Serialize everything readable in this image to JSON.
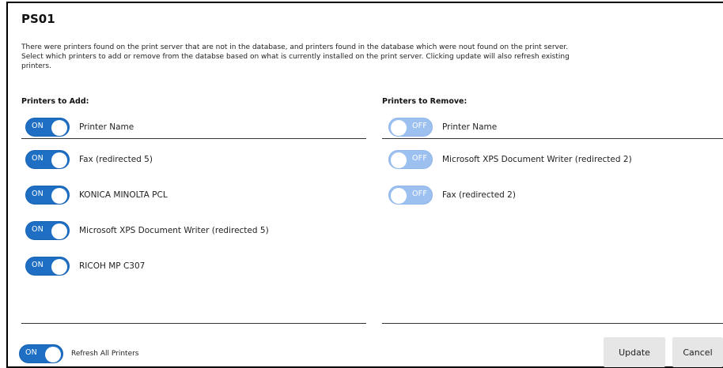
{
  "dialog": {
    "title": "PS01",
    "description": "There were printers found on the print server that are not in the database, and printers found in the database which were nout found on the print server. Select which printers to add or remove from the databse based on what is currently installed on the print server. Clicking update will also refresh existing printers."
  },
  "add_column": {
    "title": "Printers to Add:",
    "header": {
      "label": "Printer Name",
      "state": "ON"
    },
    "items": [
      {
        "label": "Fax (redirected 5)",
        "state": "ON"
      },
      {
        "label": "KONICA MINOLTA PCL",
        "state": "ON"
      },
      {
        "label": "Microsoft XPS Document Writer (redirected 5)",
        "state": "ON"
      },
      {
        "label": "RICOH MP C307",
        "state": "ON"
      }
    ]
  },
  "remove_column": {
    "title": "Printers to Remove:",
    "header": {
      "label": "Printer Name",
      "state": "OFF"
    },
    "items": [
      {
        "label": "Microsoft XPS Document Writer (redirected 2)",
        "state": "OFF"
      },
      {
        "label": "Fax (redirected 2)",
        "state": "OFF"
      }
    ]
  },
  "footer": {
    "refresh": {
      "label": "Refresh All Printers",
      "state": "ON"
    },
    "update_label": "Update",
    "cancel_label": "Cancel"
  },
  "colors": {
    "toggle_on": "#1e6fc4",
    "toggle_off": "#9cc0f0",
    "button_bg": "#e6e6e6"
  }
}
